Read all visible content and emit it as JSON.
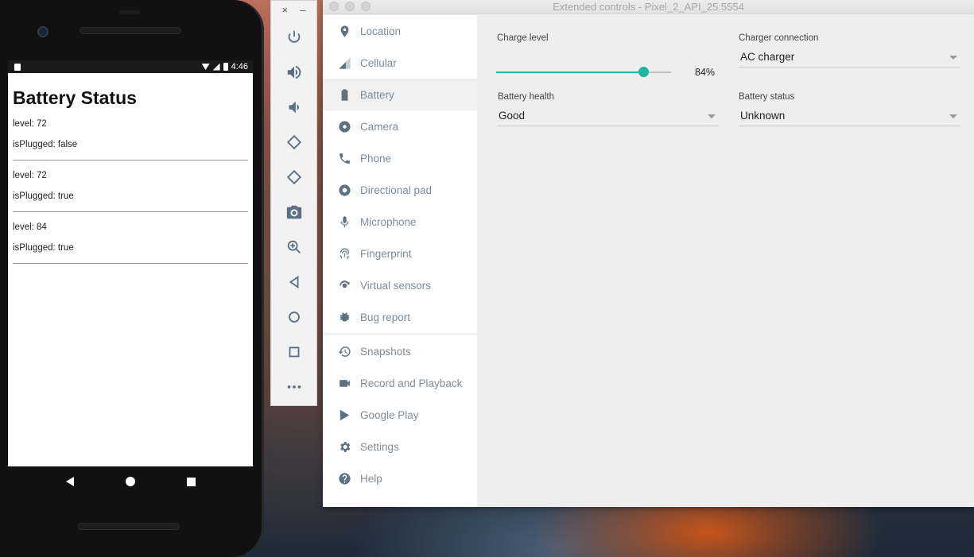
{
  "phone": {
    "status_time": "4:46",
    "app_title": "Battery Status",
    "entries": [
      {
        "level": "level: 72",
        "plugged": "isPlugged: false"
      },
      {
        "level": "level: 72",
        "plugged": "isPlugged: true"
      },
      {
        "level": "level: 84",
        "plugged": "isPlugged: true"
      }
    ]
  },
  "toolbar": {
    "close": "×",
    "minimize": "–",
    "buttons": [
      "power-icon",
      "volume-up-icon",
      "volume-down-icon",
      "rotate-left-icon",
      "rotate-right-icon",
      "camera-icon",
      "zoom-icon",
      "back-icon",
      "home-icon",
      "overview-icon",
      "more-icon"
    ]
  },
  "window": {
    "title": "Extended controls - Pixel_2_API_25:5554"
  },
  "nav": {
    "items": [
      {
        "label": "Location",
        "icon": "location-pin-icon"
      },
      {
        "label": "Cellular",
        "icon": "cellular-signal-icon"
      },
      {
        "label": "Battery",
        "icon": "battery-icon",
        "active": true
      },
      {
        "label": "Camera",
        "icon": "camera-aperture-icon"
      },
      {
        "label": "Phone",
        "icon": "phone-handset-icon"
      },
      {
        "label": "Directional pad",
        "icon": "dpad-icon"
      },
      {
        "label": "Microphone",
        "icon": "microphone-icon"
      },
      {
        "label": "Fingerprint",
        "icon": "fingerprint-icon"
      },
      {
        "label": "Virtual sensors",
        "icon": "virtual-sensors-icon"
      },
      {
        "label": "Bug report",
        "icon": "bug-icon"
      }
    ],
    "items2": [
      {
        "label": "Snapshots",
        "icon": "history-icon"
      },
      {
        "label": "Record and Playback",
        "icon": "video-camera-icon"
      },
      {
        "label": "Google Play",
        "icon": "play-store-icon"
      },
      {
        "label": "Settings",
        "icon": "gear-icon"
      },
      {
        "label": "Help",
        "icon": "help-icon"
      }
    ]
  },
  "battery": {
    "charge_level_label": "Charge level",
    "charge_level": 84,
    "charge_level_text": "84%",
    "charger_connection_label": "Charger connection",
    "charger_connection": "AC charger",
    "battery_health_label": "Battery health",
    "battery_health": "Good",
    "battery_status_label": "Battery status",
    "battery_status": "Unknown",
    "accent_color": "#1ab5a3"
  }
}
